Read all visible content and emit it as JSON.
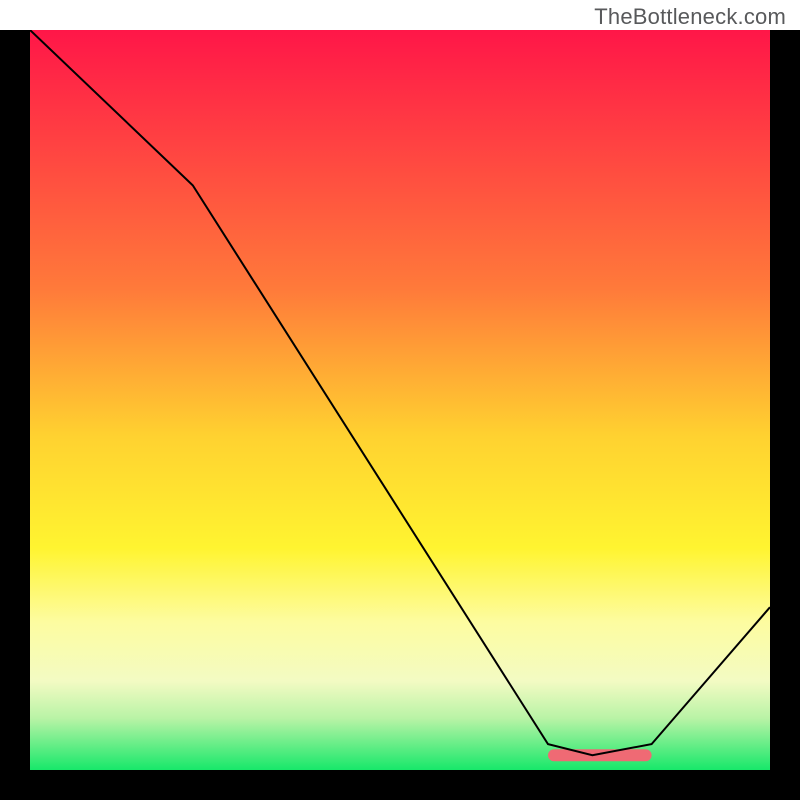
{
  "watermark": "TheBottleneck.com",
  "chart_data": {
    "type": "line",
    "title": "",
    "xlabel": "",
    "ylabel": "",
    "xlim": [
      0,
      100
    ],
    "ylim": [
      0,
      100
    ],
    "grid": false,
    "legend": false,
    "gradient_stops": [
      {
        "offset": 0,
        "color": "#ff1648"
      },
      {
        "offset": 35,
        "color": "#ff7a3a"
      },
      {
        "offset": 55,
        "color": "#ffd230"
      },
      {
        "offset": 70,
        "color": "#fff430"
      },
      {
        "offset": 80,
        "color": "#fdfca0"
      },
      {
        "offset": 88,
        "color": "#f3fbc3"
      },
      {
        "offset": 93,
        "color": "#b9f3a6"
      },
      {
        "offset": 100,
        "color": "#17e86a"
      }
    ],
    "series": [
      {
        "name": "bottleneck-curve",
        "x": [
          0,
          22,
          70,
          76,
          84,
          100
        ],
        "values": [
          100,
          79,
          3.5,
          2.0,
          3.5,
          22
        ]
      }
    ],
    "marker_zone": {
      "name": "optimal-zone-marker",
      "color": "#ef6a74",
      "x_start": 70,
      "x_end": 84,
      "y": 2.0
    }
  }
}
